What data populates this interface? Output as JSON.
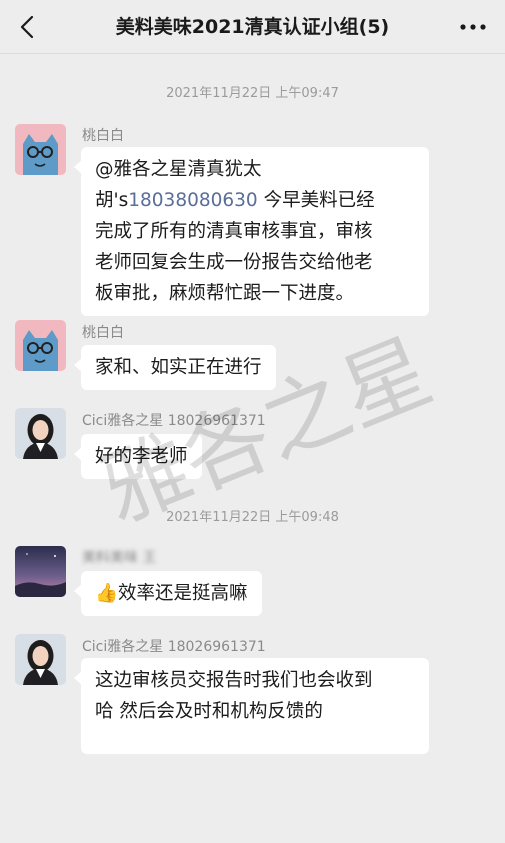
{
  "header": {
    "title": "美料美味2021清真认证小组(5)",
    "back_icon": "chevron-left",
    "more_icon": "ellipsis"
  },
  "timestamps": [
    "2021年11月22日 上午09:47",
    "2021年11月22日 上午09:48"
  ],
  "messages": [
    {
      "sender": "桃白白",
      "lines": [
        "@雅各之星清真犹太",
        "胡's",
        "18038080630",
        " 今早美料已经",
        "完成了所有的清真审核事宜，审核",
        "老师回复会生成一份报告交给他老",
        "板审批，麻烦帮忙跟一下进度。"
      ]
    },
    {
      "sender": "桃白白",
      "text": "家和、如实正在进行"
    },
    {
      "sender": "Cici雅各之星 18026961371",
      "text": "好的李老师"
    },
    {
      "sender": "美料美味 王",
      "emoji": "👍",
      "text": "效率还是挺高嘛"
    },
    {
      "sender": "Cici雅各之星 18026961371",
      "lines": [
        "这边审核员交报告时我们也会收到",
        "哈 然后会及时和机构反馈的"
      ]
    }
  ],
  "watermark": "雅各之星",
  "colors": {
    "background": "#ededed",
    "bubble": "#ffffff",
    "link": "#5a6e9a"
  }
}
